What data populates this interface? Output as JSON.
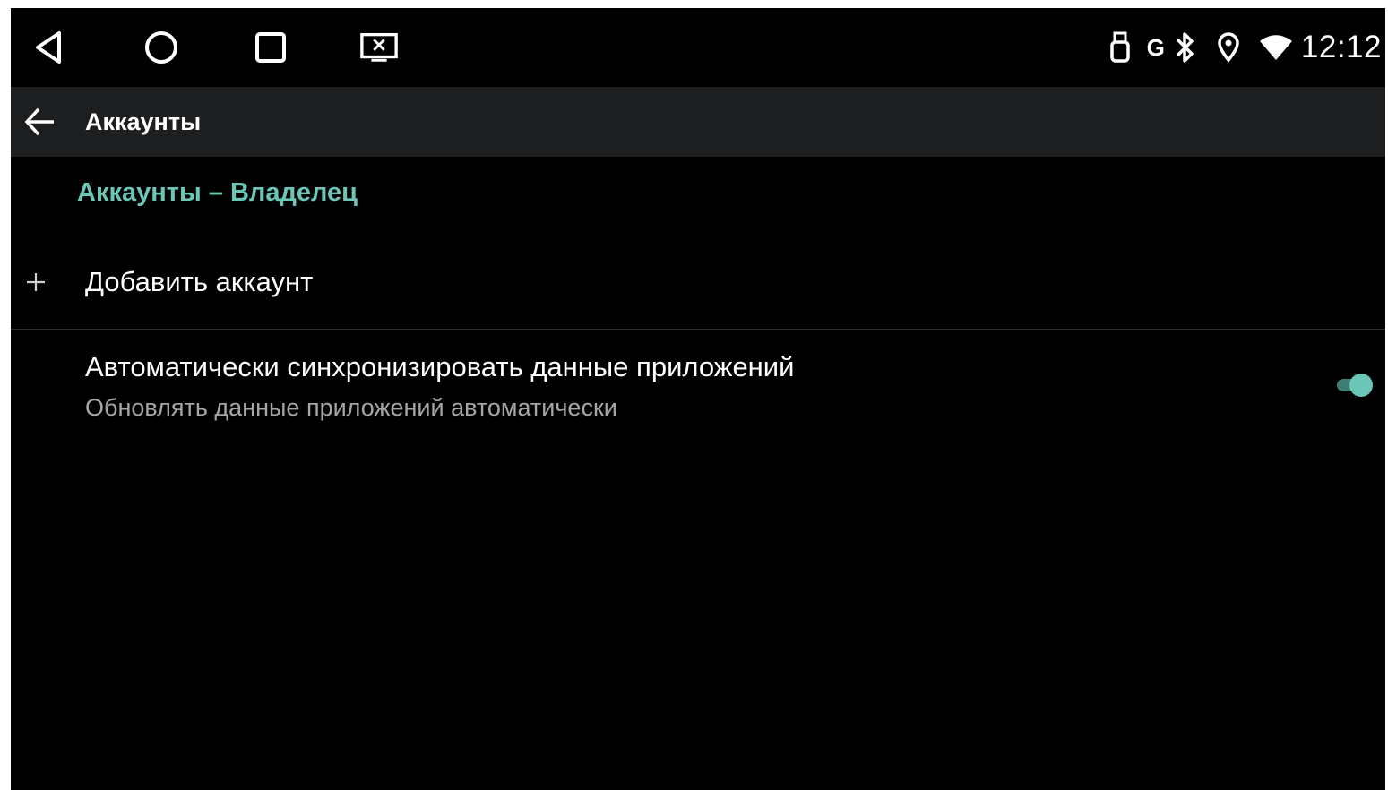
{
  "status_bar": {
    "nav_buttons": [
      {
        "name": "back-nav-icon"
      },
      {
        "name": "home-nav-icon"
      },
      {
        "name": "recents-nav-icon"
      },
      {
        "name": "screenshot-nav-icon"
      }
    ],
    "icons": [
      "usb-drive-icon",
      "g-network-icon",
      "bluetooth-icon",
      "location-icon",
      "wifi-icon"
    ],
    "network_label": "G",
    "clock": "12:12"
  },
  "app_bar": {
    "title": "Аккаунты",
    "back_icon": "arrow-back-icon"
  },
  "content": {
    "section_header": "Аккаунты – Владелец",
    "add_account": {
      "icon": "plus-icon",
      "label": "Добавить аккаунт"
    },
    "auto_sync": {
      "title": "Автоматически синхронизировать данные приложений",
      "summary": "Обновлять данные приложений автоматически",
      "enabled": true
    }
  },
  "colors": {
    "accent": "#6bc6b8",
    "toggle_track": "#3d7e75",
    "background": "#000000",
    "app_bar": "#1c1e20",
    "secondary_text": "#a6a6a6"
  }
}
